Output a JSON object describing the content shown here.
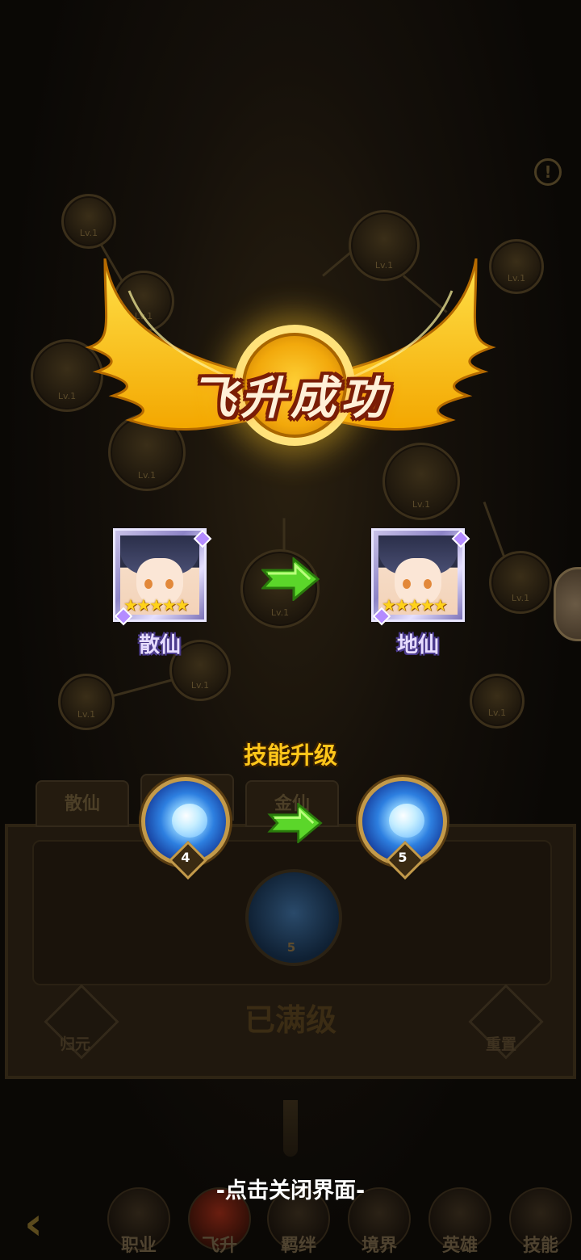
{
  "popup": {
    "title": "飞升成功",
    "from_card": {
      "label": "散仙",
      "stars": "★★★★★"
    },
    "to_card": {
      "label": "地仙",
      "stars": "★★★★★"
    },
    "skill_heading": "技能升级",
    "skill_from_level": "4",
    "skill_to_level": "5",
    "close_hint": "-点击关闭界面-"
  },
  "background": {
    "node_level_label": "Lv.1",
    "tabs": [
      "散仙",
      "",
      "金仙"
    ],
    "max_level_text": "已满级",
    "left_button_label": "归元",
    "right_button_label": "重置",
    "skill_level": "5",
    "bottom_nav": [
      "职业",
      "飞升",
      "羁绊",
      "境界",
      "英雄",
      "技能"
    ]
  },
  "colors": {
    "gold": "#ffc61a",
    "arrow_green": "#5bd62a",
    "card_label": "#e6dcff"
  }
}
